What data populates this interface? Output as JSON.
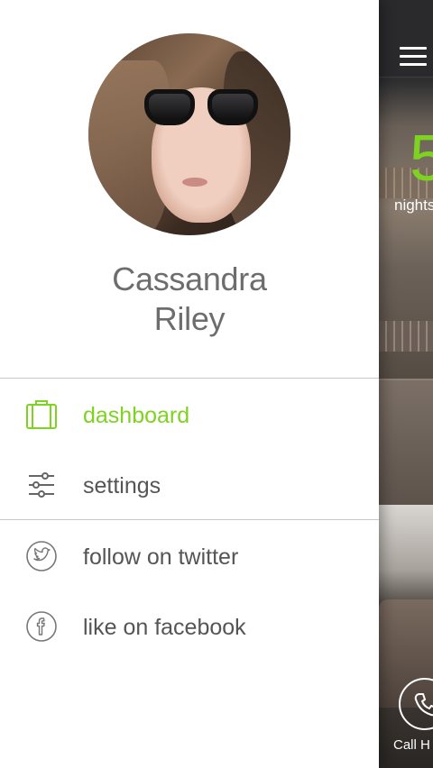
{
  "profile": {
    "first_name": "Cassandra",
    "last_name": "Riley"
  },
  "menu": {
    "primary": [
      {
        "label": "dashboard",
        "icon": "luggage-icon",
        "active": true
      },
      {
        "label": "settings",
        "icon": "sliders-icon",
        "active": false
      }
    ],
    "social": [
      {
        "label": "follow on twitter",
        "icon": "twitter-icon"
      },
      {
        "label": "like on facebook",
        "icon": "facebook-icon"
      }
    ]
  },
  "main": {
    "nights_count": "5",
    "nights_label": "nights",
    "call_label": "Call H"
  },
  "colors": {
    "accent": "#7ed321",
    "menu_text": "#555555",
    "name_text": "#6d6d6d",
    "divider": "#c8c8c8"
  }
}
